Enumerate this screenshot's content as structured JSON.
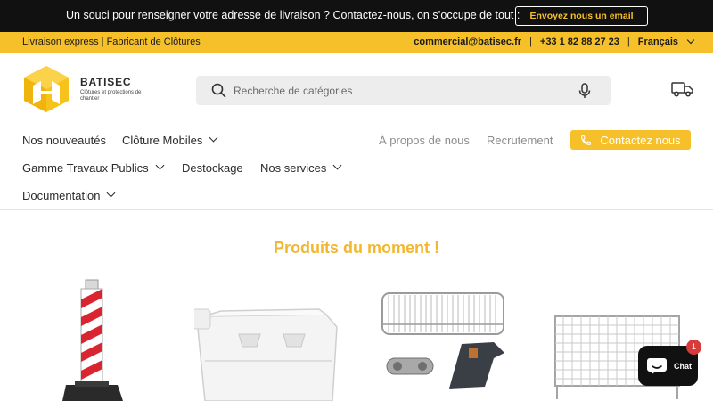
{
  "announcement": {
    "text": "Un souci pour renseigner votre adresse de livraison ? Contactez-nous, on s’occupe de tout :",
    "button_label": "Envoyez nous un email"
  },
  "infobar": {
    "left_text": "Livraison express | Fabricant de Clôtures",
    "email": "commercial@batisec.fr",
    "phone": "+33 1 82 88 27 23",
    "language": "Français"
  },
  "logo": {
    "name": "BATISEC",
    "tagline": "Clôtures et protections de chantier"
  },
  "search": {
    "placeholder": "Recherche de catégories"
  },
  "nav": {
    "items": [
      {
        "label": "Nos nouveautés"
      },
      {
        "label": "Clôture Mobiles"
      },
      {
        "label": "Gamme Travaux Publics"
      },
      {
        "label": "Destockage"
      },
      {
        "label": "Nos services"
      },
      {
        "label": "Documentation"
      }
    ],
    "about_label": "À propos de nous",
    "recruit_label": "Recrutement",
    "contact_label": "Contactez nous"
  },
  "section": {
    "title": "Produits du moment !"
  },
  "chat": {
    "label": "Chat",
    "badge": "1"
  },
  "colors": {
    "accent": "#f5c02a",
    "title": "#f2b731",
    "dark": "#111111"
  },
  "icons": [
    "search-icon",
    "microphone-icon",
    "delivery-truck-icon",
    "phone-icon",
    "chat-icon",
    "chevron-down-icon"
  ]
}
